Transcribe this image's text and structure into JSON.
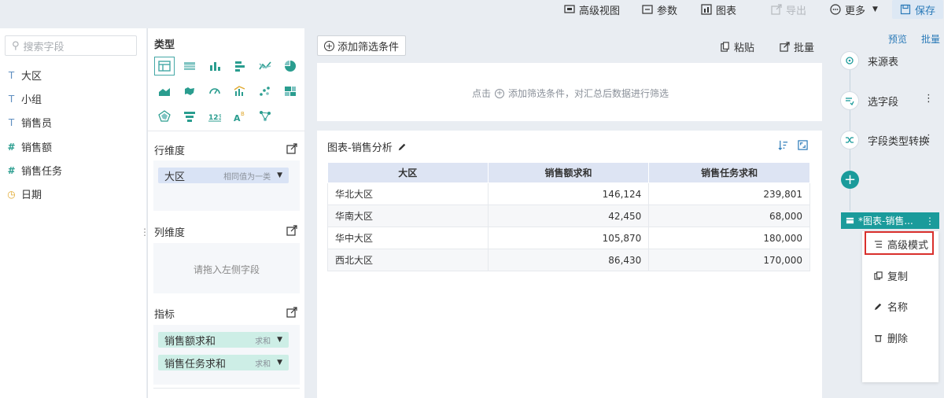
{
  "toolbar": {
    "advanced_view": "高级视图",
    "params": "参数",
    "chart": "图表",
    "export": "导出",
    "more": "更多",
    "save": "保存"
  },
  "fields": {
    "search_placeholder": "搜索字段",
    "items": [
      {
        "label": "大区",
        "type": "text-geo"
      },
      {
        "label": "小组",
        "type": "text"
      },
      {
        "label": "销售员",
        "type": "text"
      },
      {
        "label": "销售额",
        "type": "number-geo"
      },
      {
        "label": "销售任务",
        "type": "number-geo"
      },
      {
        "label": "日期",
        "type": "date"
      }
    ]
  },
  "config": {
    "type_title": "类型",
    "row_dim_title": "行维度",
    "col_dim_title": "列维度",
    "metrics_title": "指标",
    "row_pill": {
      "label": "大区",
      "sub": "相同值为一类"
    },
    "col_hint": "请拖入左侧字段",
    "metric_pills": [
      {
        "label": "销售额求和",
        "sub": "求和"
      },
      {
        "label": "销售任务求和",
        "sub": "求和"
      }
    ]
  },
  "filter": {
    "add_label": "添加筛选条件",
    "paste": "粘贴",
    "batch": "批量",
    "hint_prefix": "点击",
    "hint_suffix": "添加筛选条件，对汇总后数据进行筛选"
  },
  "table": {
    "title": "图表-销售分析",
    "columns": [
      "大区",
      "销售额求和",
      "销售任务求和"
    ],
    "rows": [
      [
        "华北大区",
        "146,124",
        "239,801"
      ],
      [
        "华南大区",
        "42,450",
        "68,000"
      ],
      [
        "华中大区",
        "105,870",
        "180,000"
      ],
      [
        "西北大区",
        "86,430",
        "170,000"
      ]
    ]
  },
  "steps": {
    "preview": "预览",
    "batch": "批量",
    "source": "来源表",
    "select_field": "选字段",
    "field_convert": "字段类型转换",
    "active": "*图表-销售...",
    "menu": [
      "高级模式",
      "复制",
      "名称",
      "删除"
    ]
  },
  "colors": {
    "accent": "#1a9b9b",
    "highlight": "#d9302c",
    "link": "#2a7ab8"
  }
}
